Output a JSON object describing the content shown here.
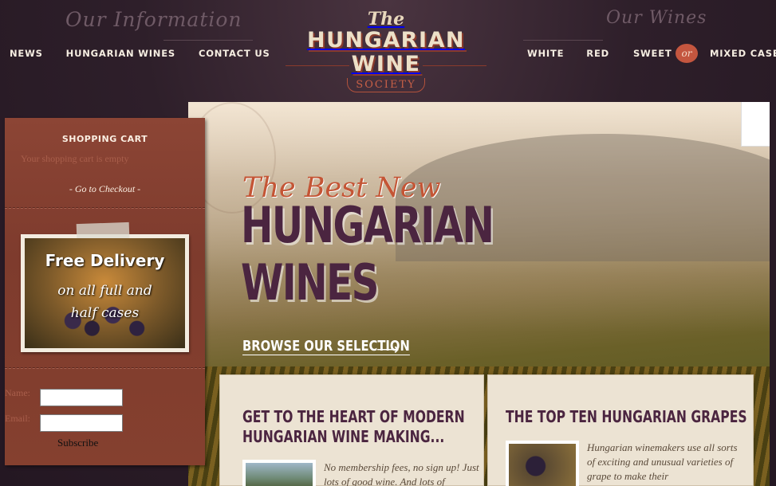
{
  "header": {
    "info_heading": "Our Information",
    "wines_heading": "Our Wines",
    "left_nav": [
      "NEWS",
      "HUNGARIAN WINES",
      "CONTACT US"
    ],
    "right_nav": [
      "WHITE",
      "RED",
      "SWEET"
    ],
    "or_label": "or",
    "mixed_case": "MIXED CASE"
  },
  "logo": {
    "the": "The",
    "name": "HUNGARIAN WINE",
    "society": "SOCIETY"
  },
  "sidebar": {
    "cart_title": "SHOPPING CART",
    "cart_empty": "Your shopping cart is empty",
    "checkout": "- Go to Checkout -",
    "promo_title": "Free Delivery",
    "promo_sub": "on all full and half cases",
    "name_label": "Name:",
    "email_label": "Email:",
    "name_value": "",
    "email_value": "",
    "subscribe": "Subscribe"
  },
  "hero": {
    "script": "The Best New",
    "line1": "HUNGARIAN",
    "line2": "WINES",
    "browse": "BROWSE OUR SELECTION",
    "browse_arrow": "⟶"
  },
  "panels": [
    {
      "title_line1": "GET TO THE HEART OF MODERN",
      "title_line2": "HUNGARIAN WINE MAKING...",
      "text": "No membership fees, no sign up! Just lots of good wine. And lots of"
    },
    {
      "title_line1": "THE TOP TEN HUNGARIAN GRAPES",
      "title_line2": "",
      "text": "Hungarian winemakers use all sorts of exciting and unusual varieties of grape to make their"
    }
  ],
  "colors": {
    "background": "#2e1f2a",
    "sidebar": "#8c4535",
    "accent": "#c4563f",
    "heading": "#4b2540"
  }
}
